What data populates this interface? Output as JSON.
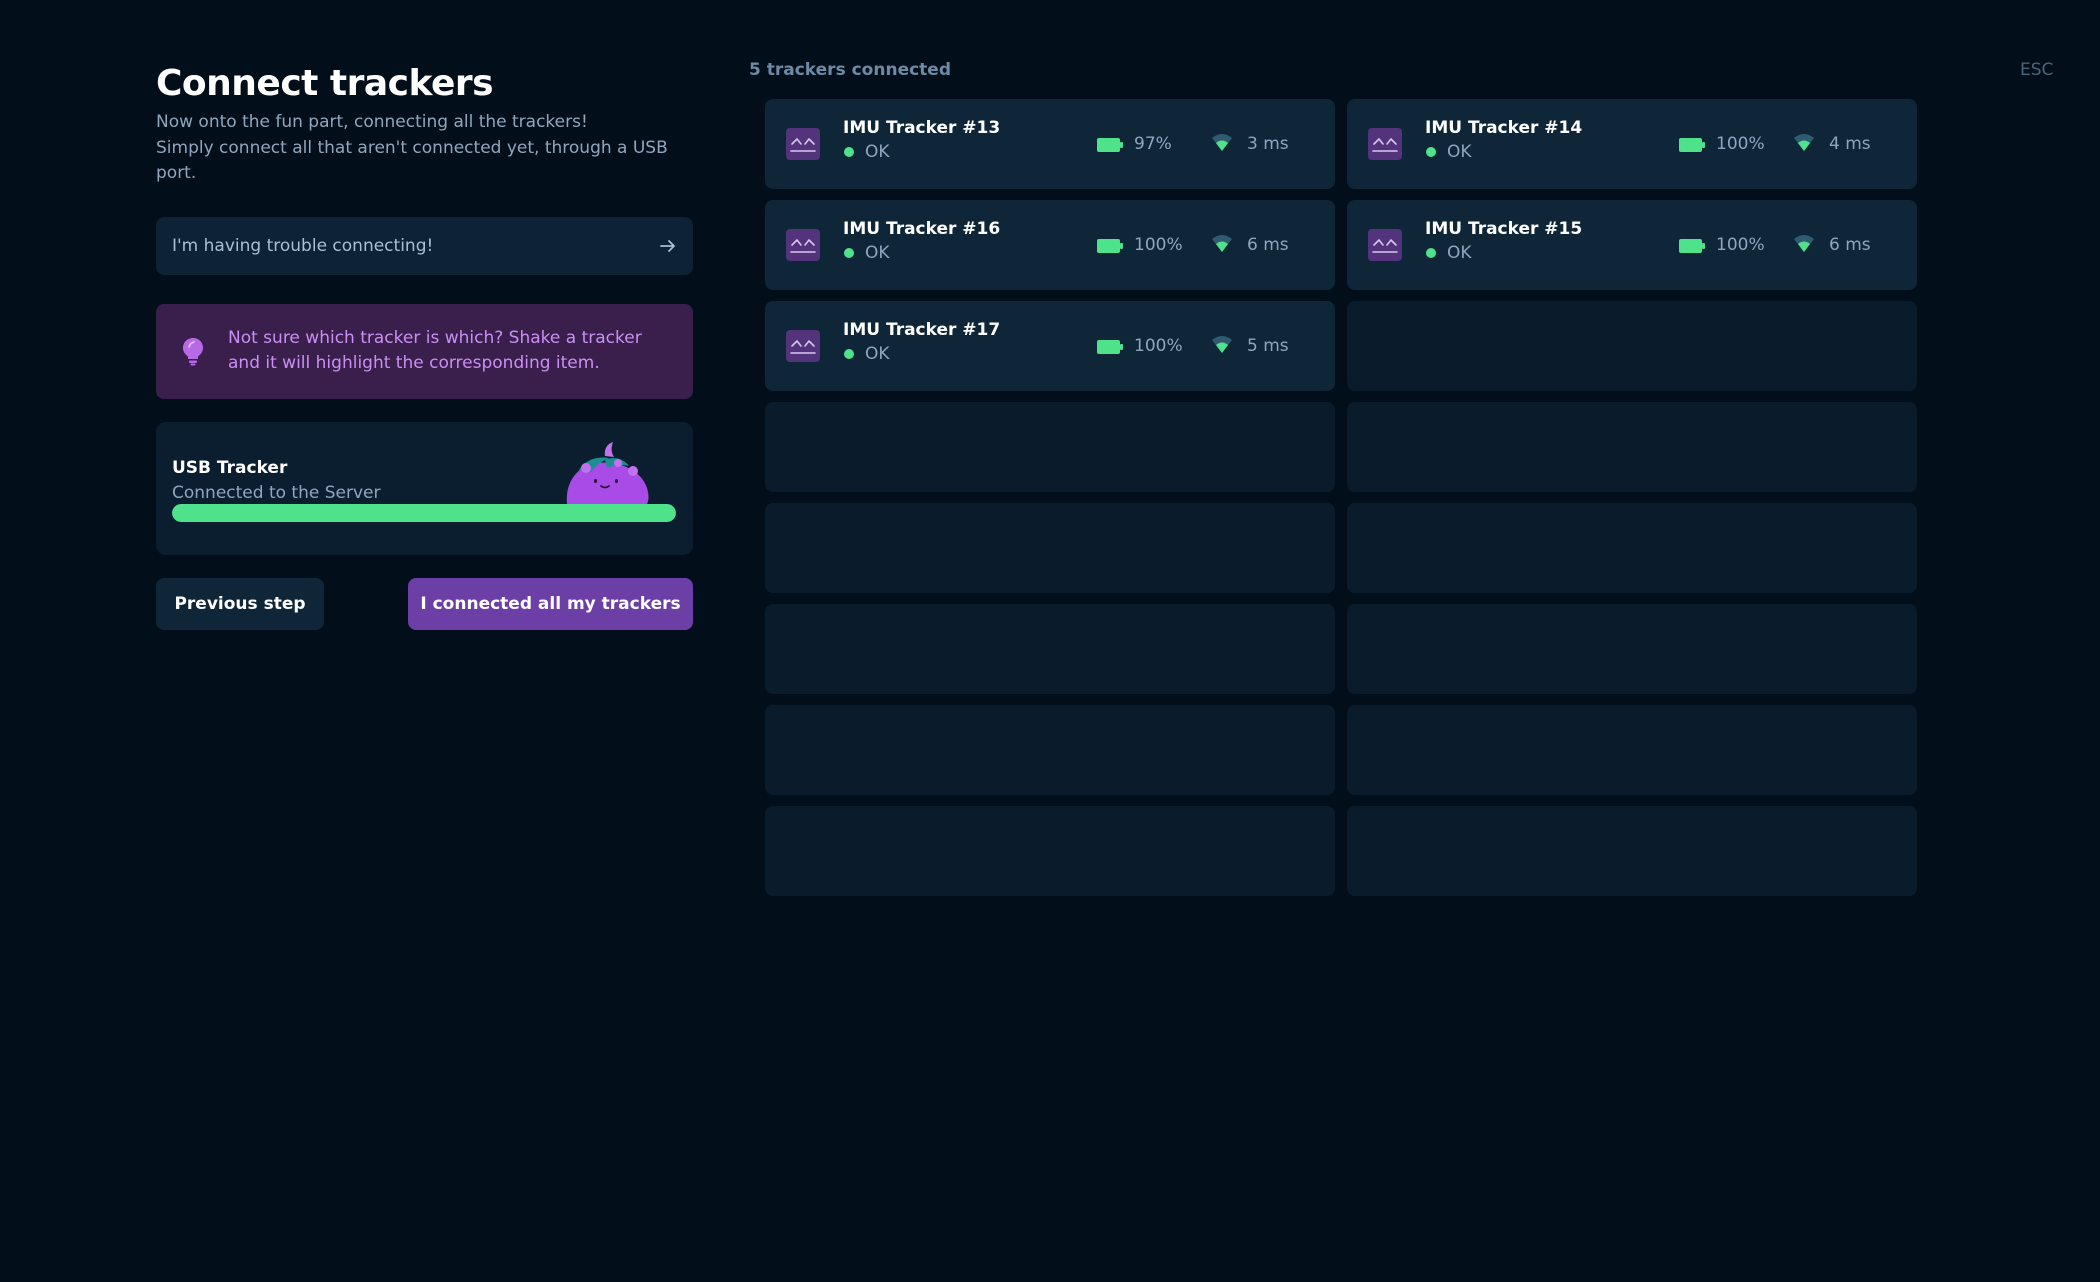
{
  "esc_label": "ESC",
  "header": {
    "title": "Connect trackers",
    "description_line1": "Now onto the fun part, connecting all the trackers!",
    "description_line2": "Simply connect all that aren't connected yet, through a USB",
    "description_line3": "port."
  },
  "help_link": {
    "label": "I'm having trouble connecting!",
    "icon": "arrow-right-icon"
  },
  "tip": {
    "line1": "Not sure which tracker is which? Shake a tracker",
    "line2": "and it will highlight the corresponding item.",
    "icon": "lightbulb-icon"
  },
  "usb_tracker": {
    "name": "USB Tracker",
    "status": "Connected to the Server",
    "progress": 1.0
  },
  "actions": {
    "previous": "Previous step",
    "done": "I connected all my trackers"
  },
  "trackers_connected": "5 trackers connected",
  "trackers": [
    {
      "name": "IMU Tracker #13",
      "status": "OK",
      "battery": "97%",
      "ping": "3 ms"
    },
    {
      "name": "IMU Tracker #14",
      "status": "OK",
      "battery": "100%",
      "ping": "4 ms"
    },
    {
      "name": "IMU Tracker #16",
      "status": "OK",
      "battery": "100%",
      "ping": "6 ms"
    },
    {
      "name": "IMU Tracker #15",
      "status": "OK",
      "battery": "100%",
      "ping": "6 ms"
    },
    {
      "name": "IMU Tracker #17",
      "status": "OK",
      "battery": "100%",
      "ping": "5 ms"
    }
  ],
  "empty_slots": 11,
  "colors": {
    "background": "#020f1b",
    "accent_purple": "#6b3fa6",
    "status_green": "#4ee28b",
    "tip_text": "#c98ff2"
  }
}
